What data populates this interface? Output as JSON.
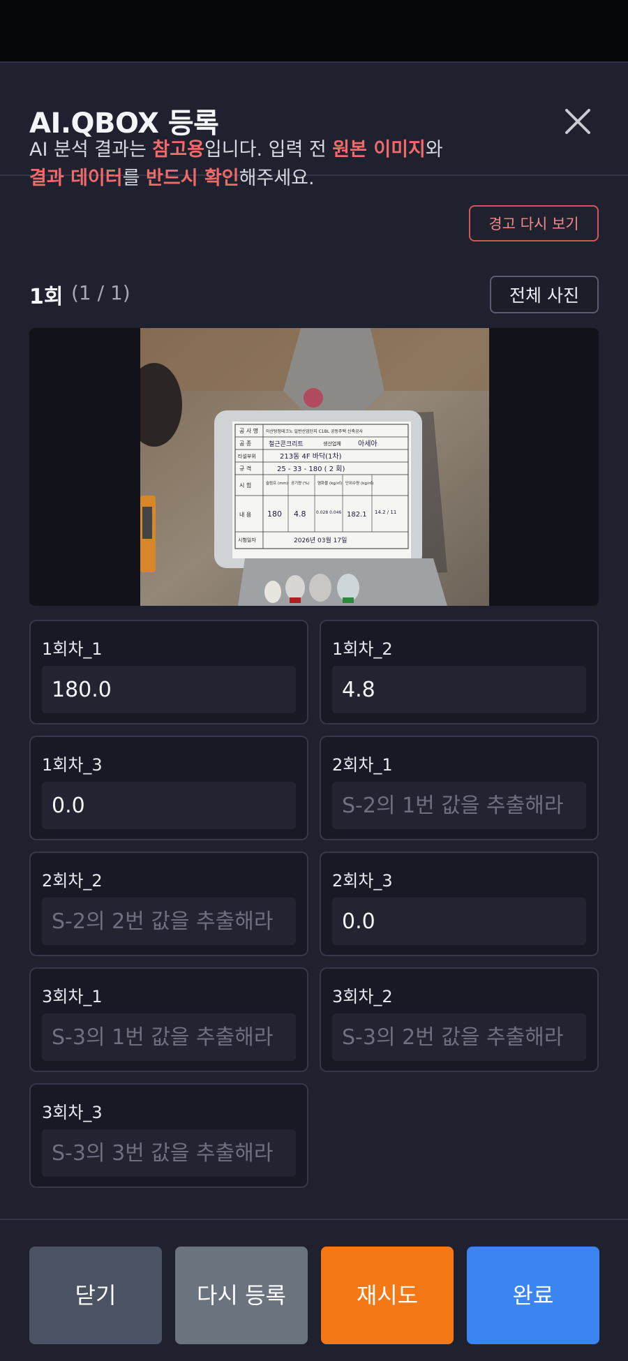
{
  "modal": {
    "title": "AI.QBOX 등록",
    "close_icon": "close-icon"
  },
  "notice": {
    "part1": "AI 분석 결과는 ",
    "hl1": "참고용",
    "part2": "입니다. 입력 전 ",
    "hl2": "원본 이미지",
    "part3": "와 ",
    "hl3": "결과 데이터",
    "part4": "를 ",
    "hl4": "반드시 확인",
    "part5": "해주세요.",
    "warning_button": "경고 다시 보기",
    "highlight_color": "#f06a6a"
  },
  "round": {
    "title": "1회",
    "count": "(1 / 1)",
    "all_photos_button": "전체 사진"
  },
  "photo": {
    "board": {
      "row1_label": "공 사 명",
      "row1_value": "아산탕정테크노 일반산업단지 C1BL 공동주택 신축공사",
      "row2_label": "공    종",
      "row2_value": "철근콘크리트",
      "row2_label_b": "생산업체",
      "row2_value_b": "아세아",
      "row3_label": "타설부위",
      "row3_value": "213동 4F 바닥(1차)",
      "row4_label": "규    격",
      "row4_value": "25 - 33 - 180  ( 2 회)",
      "row5_label": "시    험",
      "col_slump": "슬럼프 (mm)",
      "col_air": "공기량 (%)",
      "col_chloride": "염화물 (kg/㎥)",
      "col_unit": "단위수량 (kg/㎥)",
      "row6_label": "내    용",
      "val_slump": "180",
      "val_air": "4.8",
      "val_chloride": "0.028 0.046",
      "val_unit": "182.1",
      "val_extra": "14.2 / 11",
      "row7_label": "시험일자",
      "row7_value": "2026년 03월 17일"
    }
  },
  "fields": [
    {
      "label": "1회차_1",
      "value": "180.0",
      "placeholder": ""
    },
    {
      "label": "1회차_2",
      "value": "4.8",
      "placeholder": ""
    },
    {
      "label": "1회차_3",
      "value": "0.0",
      "placeholder": ""
    },
    {
      "label": "2회차_1",
      "value": "",
      "placeholder": "S-2의 1번 값을 추출해라"
    },
    {
      "label": "2회차_2",
      "value": "",
      "placeholder": "S-2의 2번 값을 추출해라"
    },
    {
      "label": "2회차_3",
      "value": "0.0",
      "placeholder": ""
    },
    {
      "label": "3회차_1",
      "value": "",
      "placeholder": "S-3의 1번 값을 추출해라"
    },
    {
      "label": "3회차_2",
      "value": "",
      "placeholder": "S-3의 2번 값을 추출해라"
    },
    {
      "label": "3회차_3",
      "value": "",
      "placeholder": "S-3의 3번 값을 추출해라"
    }
  ],
  "footer": {
    "close_button": "닫기",
    "reregister_button": "다시 등록",
    "retry_button": "재시도",
    "done_button": "완료",
    "colors": {
      "close": "#4b5261",
      "reregister": "#6b737f",
      "retry": "#f57816",
      "done": "#3a85f2"
    }
  }
}
